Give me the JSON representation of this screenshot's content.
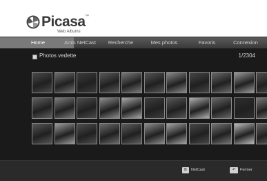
{
  "app": {
    "logo_text": "Picasa",
    "logo_tm": "™",
    "logo_subtitle": "Web Albums"
  },
  "nav": {
    "items": [
      {
        "label": "Home",
        "active": true
      },
      {
        "label": "Amis NetCast",
        "active": false
      },
      {
        "label": "Recherche",
        "active": false
      },
      {
        "label": "Mes photos",
        "active": false
      },
      {
        "label": "Favoris",
        "active": false
      },
      {
        "label": "Connexion",
        "active": false
      }
    ]
  },
  "section": {
    "title": "Photos vedette",
    "page_count": "1/2304"
  },
  "grid": {
    "rows": 3,
    "columns": 11,
    "tones": [
      [
        "#4a4a4a",
        "#6e6e6e",
        "#3c3c3c",
        "#5a5a5a",
        "#7a7a7a",
        "#555555",
        "#8a8a8a",
        "#464646",
        "#6a6a6a",
        "#9a9a9a",
        "#505050"
      ],
      [
        "#606060",
        "#7c7c7c",
        "#4c4c4c",
        "#8e8e8e",
        "#a8a8a8",
        "#3e3e3e",
        "#585858",
        "#b0b0b0",
        "#686868",
        "#2e2e2e",
        "#777777"
      ],
      [
        "#565656",
        "#9c9c9c",
        "#4e4e4e",
        "#6c6c6c",
        "#5e5e5e",
        "#8c8c8c",
        "#a4a4a4",
        "#484848",
        "#747474",
        "#bcbcbc",
        "#626262"
      ]
    ]
  },
  "footer": {
    "buttons": [
      {
        "key": "B",
        "label": "NetCast"
      },
      {
        "key": "↶",
        "label": "Fermer"
      }
    ]
  }
}
